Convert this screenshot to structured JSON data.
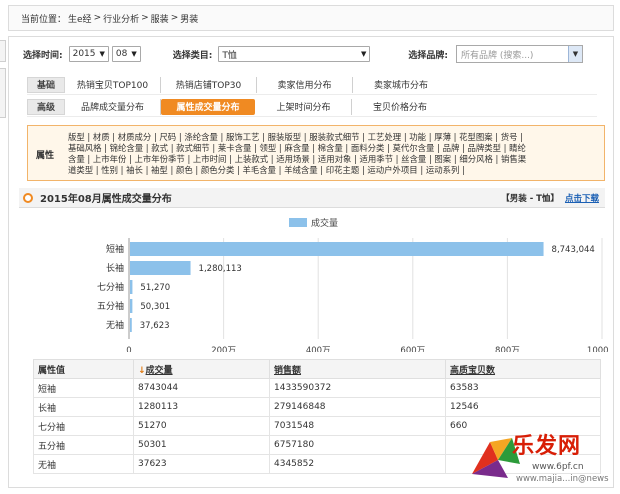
{
  "breadcrumb": {
    "label": "当前位置：",
    "items": [
      "生e经",
      ">",
      "行业分析",
      ">",
      "服装",
      ">",
      "男装"
    ]
  },
  "filters": {
    "time_label": "选择时间:",
    "year": "2015",
    "month": "08",
    "category_label": "选择类目:",
    "category": "T恤",
    "brand_label": "选择品牌:",
    "brand_placeholder": "所有品牌 (搜索...)"
  },
  "menu": {
    "rows": [
      {
        "category": "基础",
        "items": [
          "热销宝贝TOP100",
          "热销店铺TOP30",
          "卖家信用分布",
          "卖家城市分布"
        ],
        "active": -1
      },
      {
        "category": "高级",
        "items": [
          "品牌成交量分布",
          "属性成交量分布",
          "上架时间分布",
          "宝贝价格分布"
        ],
        "active": 1
      }
    ]
  },
  "attributes": {
    "label": "属性",
    "lines": [
      "版型 | 材质 | 材质成分 | 尺码 | 涤纶含量 | 服饰工艺 | 服装版型 | 服装款式细节 | 工艺处理 | 功能 | 厚薄 | 花型图案 | 货号 |",
      "基础风格 | 锦纶含量 | 款式 | 款式细节 | 莱卡含量 | 领型 | 麻含量 | 棉含量 | 面料分类 | 莫代尔含量 | 品牌 | 品牌类型 | 睛纶",
      "含量 | 上市年份 | 上市年份季节 | 上市时间 | 上装款式 | 适用场景 | 适用对象 | 适用季节 | 丝含量 | 图案 | 细分风格 | 销售渠",
      "道类型 | 性别 | 袖长 | 袖型 | 颜色 | 颜色分类 | 羊毛含量 | 羊绒含量 | 印花主题 | 运动户外项目 | 运动系列 |"
    ]
  },
  "section": {
    "title": "2015年08月属性成交量分布",
    "tag": "【男装 - T恤】",
    "download": "点击下载"
  },
  "chart_data": {
    "type": "bar",
    "orientation": "horizontal",
    "legend": "成交量",
    "legend_position": "top",
    "categories": [
      "短袖",
      "长袖",
      "七分袖",
      "五分袖",
      "无袖"
    ],
    "values": [
      8743044,
      1280113,
      51270,
      50301,
      37623
    ],
    "value_labels": [
      "8,743,044",
      "1,280,113",
      "51,270",
      "50,301",
      "37,623"
    ],
    "xlim": [
      0,
      10000000
    ],
    "ticks": [
      0,
      2000000,
      4000000,
      6000000,
      8000000,
      10000000
    ],
    "tick_labels": [
      "0",
      "200万",
      "400万",
      "600万",
      "800万",
      "1000万"
    ],
    "grid": true,
    "bar_color": "#8cc1ea"
  },
  "table": {
    "headers": [
      "属性值",
      "成交量",
      "销售额",
      "高质宝贝数"
    ],
    "sort_indicator": "↓",
    "rows": [
      [
        "短袖",
        "8743044",
        "1433590372",
        "63583"
      ],
      [
        "长袖",
        "1280113",
        "279146848",
        "12546"
      ],
      [
        "七分袖",
        "51270",
        "7031548",
        "660"
      ],
      [
        "五分袖",
        "50301",
        "6757180",
        ""
      ],
      [
        "无袖",
        "37623",
        "4345852",
        ""
      ]
    ]
  },
  "watermark": {
    "logo": "乐发网",
    "url": "www.6pf.cn",
    "url2": "www.majia...in@news"
  },
  "colors": {
    "accent": "#f08a22",
    "bar": "#8cc1ea",
    "link": "#1a5fb4",
    "watermark": "#d81e06"
  }
}
